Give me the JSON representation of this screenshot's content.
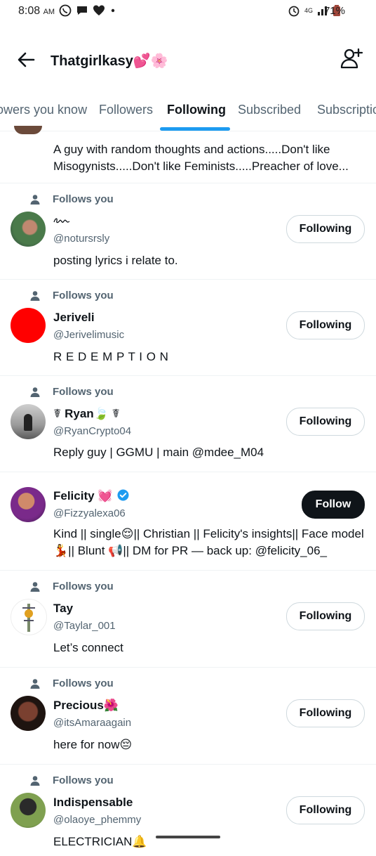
{
  "status_bar": {
    "time": "8:08",
    "ampm": "AM",
    "network": "4G",
    "battery": "71%",
    "icons": [
      "whatsapp-icon",
      "chat-icon",
      "heart-icon",
      "dot-icon",
      "alarm-icon",
      "signal-icon",
      "battery-icon"
    ]
  },
  "header": {
    "title": "Thatgirlkasy💕🌸",
    "back_icon": "back-arrow-icon",
    "add_user_icon": "add-user-icon"
  },
  "tabs": [
    {
      "label": "Followers you know"
    },
    {
      "label": "Followers"
    },
    {
      "label": "Following",
      "active": true
    },
    {
      "label": "Subscribed"
    },
    {
      "label": "Subscriptions"
    }
  ],
  "partial_top": {
    "bio": "A guy with random thoughts and actions.....Don't like Misogynists.....Don't like Feminists.....Preacher of love..."
  },
  "follows_you_label": "Follows you",
  "users": [
    {
      "name": "",
      "handle": "@notursrsly",
      "bio": "posting lyrics i relate to.",
      "follows_you": true,
      "button": "Following",
      "avatar_color": "#3a5f45"
    },
    {
      "name": "Jeriveli",
      "handle": "@Jerivelimusic",
      "bio": "R E D E M P T I O N",
      "follows_you": true,
      "button": "Following",
      "avatar_color": "#ff0000"
    },
    {
      "name": "☤ Ryan🍃 ☤",
      "handle": "@RyanCrypto04",
      "bio": "Reply guy | GGMU | main @mdee_M04",
      "follows_you": true,
      "button": "Following",
      "avatar_color": "#6b6b6b"
    },
    {
      "name": "Felicity 💓",
      "handle": "@Fizzyalexa06",
      "bio": "Kind || single😌|| Christian || Felicity's insights|| Face model 💃|| Blunt 📢|| DM for PR — back up: @felicity_06_",
      "follows_you": false,
      "verified": true,
      "button": "Follow",
      "avatar_color": "#8a2a6f"
    },
    {
      "name": "Tay",
      "handle": "@Taylar_001",
      "bio": "Let’s connect",
      "follows_you": true,
      "button": "Following",
      "avatar_color": "#e8efe4"
    },
    {
      "name": "Precious🌺",
      "handle": "@itsAmaraagain",
      "bio": "here for now😔",
      "follows_you": true,
      "button": "Following",
      "avatar_color": "#5a2a1e"
    },
    {
      "name": "Indispensable",
      "handle": "@olaoye_phemmy",
      "bio": "ELECTRICIAN🔔",
      "follows_you": true,
      "button": "Following",
      "avatar_color": "#4f6b3a"
    }
  ]
}
